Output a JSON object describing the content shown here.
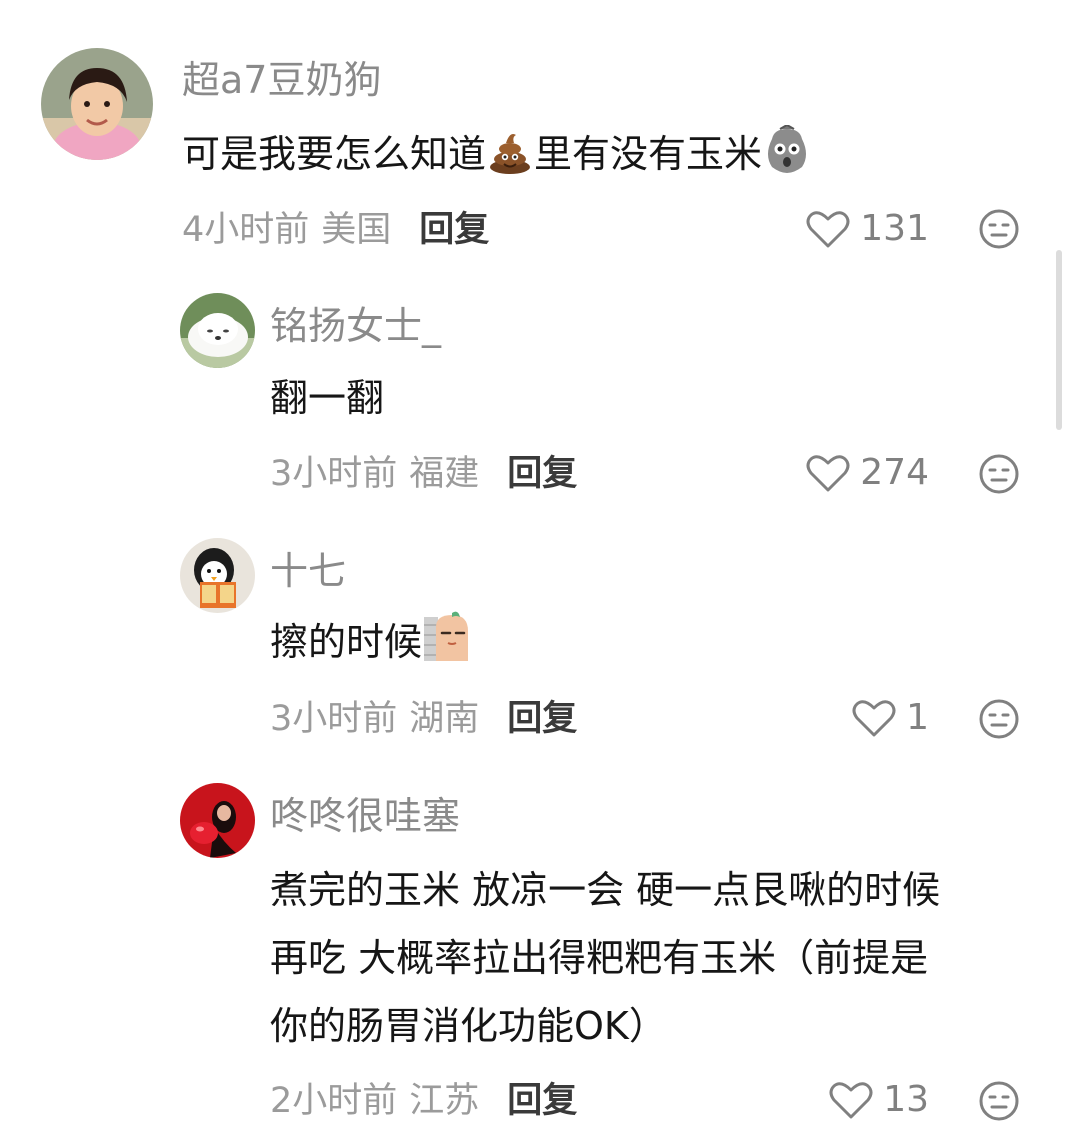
{
  "comments": [
    {
      "username": "超a7豆奶狗",
      "content_part1": "可是我要怎么知道",
      "content_emoji1": "poop-emoji",
      "content_part2": "里有没有玉米",
      "content_emoji2": "shocked-face-emoji",
      "time": "4小时前",
      "region": "美国",
      "reply_label": "回复",
      "like_count": "131",
      "avatar": "girl-avatar"
    },
    {
      "username": "铭扬女士_",
      "content": "翻一翻",
      "time": "3小时前",
      "region": "福建",
      "reply_label": "回复",
      "like_count": "274",
      "avatar": "white-dog-avatar"
    },
    {
      "username": "十七",
      "content": "擦的时候",
      "content_emoji": "peeking-potato-emoji",
      "time": "3小时前",
      "region": "湖南",
      "reply_label": "回复",
      "like_count": "1",
      "avatar": "penguin-reading-avatar"
    },
    {
      "username": "咚咚很哇塞",
      "content_lines": [
        "煮完的玉米 放凉一会 硬一点艮啾的时候",
        "再吃 大概率拉出得粑粑有玉米（前提是",
        "你的肠胃消化功能OK）"
      ],
      "time": "2小时前",
      "region": "江苏",
      "reply_label": "回复",
      "like_count": "13",
      "avatar": "red-balloon-avatar"
    }
  ],
  "colors": {
    "username": "#8a8a8a",
    "content": "#161616",
    "meta": "#9b9b9b",
    "reply": "#3a3a3a",
    "icon": "#808080"
  }
}
